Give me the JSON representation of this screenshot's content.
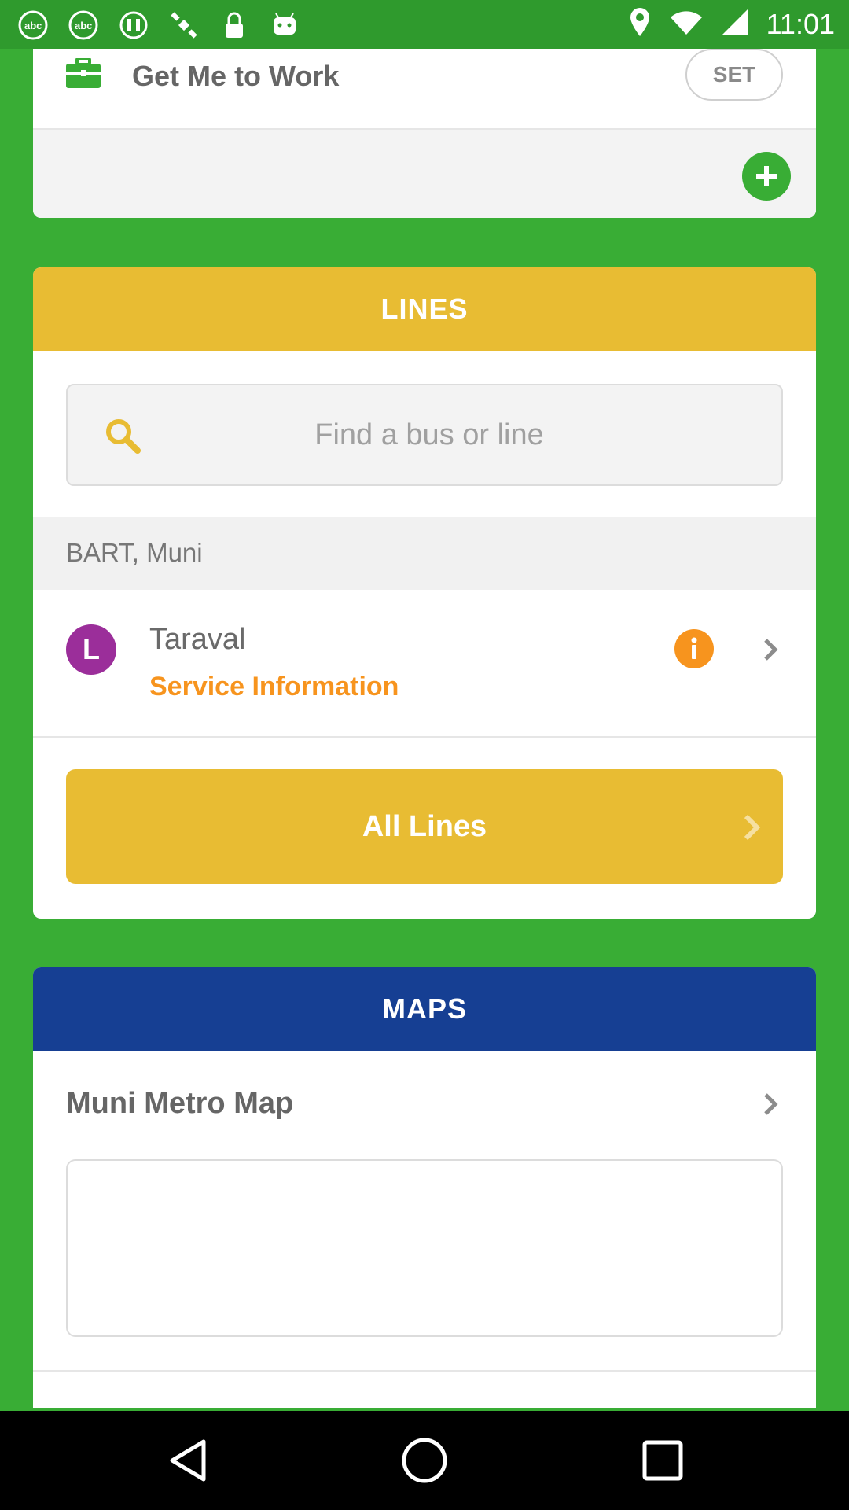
{
  "status_bar": {
    "time": "11:01",
    "icons": [
      "abc7-news-icon",
      "abc7-news-icon",
      "fake-gps-icon",
      "satellite-icon",
      "lock-icon",
      "android-icon"
    ],
    "right_icons": [
      "location-icon",
      "wifi-icon",
      "signal-icon"
    ]
  },
  "work": {
    "label": "Get Me to Work",
    "set_label": "SET",
    "icon": "briefcase-icon",
    "add_icon": "plus-icon"
  },
  "lines": {
    "header": "LINES",
    "search": {
      "placeholder": "Find a bus or line",
      "icon": "search-icon"
    },
    "agency": "BART, Muni",
    "items": [
      {
        "badge": "L",
        "name": "Taraval",
        "status": "Service Information",
        "badge_color": "#9b2e9a"
      }
    ],
    "all_lines_label": "All Lines"
  },
  "maps": {
    "header": "MAPS",
    "items": [
      {
        "title": "Muni Metro Map"
      }
    ]
  },
  "colors": {
    "background": "#39ad35",
    "lines_accent": "#e8bc33",
    "maps_accent": "#163f93",
    "service_orange": "#f7941e"
  },
  "nav_bar": {
    "buttons": [
      "back-icon",
      "home-icon",
      "recents-icon"
    ]
  }
}
